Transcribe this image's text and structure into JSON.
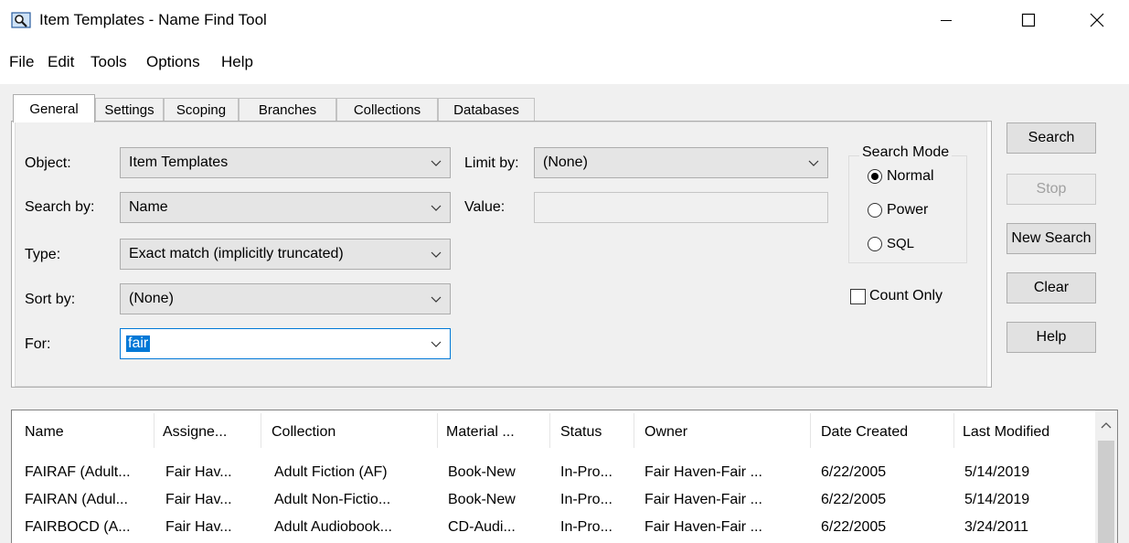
{
  "window": {
    "title": "Item Templates - Name Find Tool",
    "icon": "search-find-icon"
  },
  "menu": [
    "File",
    "Edit",
    "Tools",
    "Options",
    "Help"
  ],
  "tabs": [
    "General",
    "Settings",
    "Scoping",
    "Branches",
    "Collections",
    "Databases"
  ],
  "active_tab": "General",
  "form": {
    "object_label": "Object:",
    "object_value": "Item Templates",
    "search_by_label": "Search by:",
    "search_by_value": "Name",
    "type_label": "Type:",
    "type_value": "Exact match (implicitly truncated)",
    "sort_by_label": "Sort by:",
    "sort_by_value": "(None)",
    "for_label": "For:",
    "for_value": "fair",
    "limit_by_label": "Limit by:",
    "limit_by_value": "(None)",
    "value_label": "Value:",
    "value_value": ""
  },
  "search_mode": {
    "title": "Search Mode",
    "options": [
      "Normal",
      "Power",
      "SQL"
    ],
    "selected": "Normal"
  },
  "count_only": {
    "label": "Count Only",
    "checked": false
  },
  "buttons": {
    "search": "Search",
    "stop": "Stop",
    "new_search": "New Search",
    "clear": "Clear",
    "help": "Help"
  },
  "results": {
    "columns": [
      "Name",
      "Assigne...",
      "Collection",
      "Material ...",
      "Status",
      "Owner",
      "Date Created",
      "Last Modified"
    ],
    "rows": [
      [
        "FAIRAF (Adult...",
        "Fair Hav...",
        "Adult Fiction (AF)",
        "Book-New",
        "In-Pro...",
        "Fair Haven-Fair ...",
        "6/22/2005",
        "5/14/2019"
      ],
      [
        "FAIRAN (Adul...",
        "Fair Hav...",
        "Adult Non-Fictio...",
        "Book-New",
        "In-Pro...",
        "Fair Haven-Fair ...",
        "6/22/2005",
        "5/14/2019"
      ],
      [
        "FAIRBOCD (A...",
        "Fair Hav...",
        "Adult Audiobook...",
        "CD-Audi...",
        "In-Pro...",
        "Fair Haven-Fair ...",
        "6/22/2005",
        "3/24/2011"
      ]
    ]
  },
  "colors": {
    "selection": "#0078d7",
    "window_bg": "#f0f0f0",
    "disabled_text": "#a0a0a0"
  }
}
